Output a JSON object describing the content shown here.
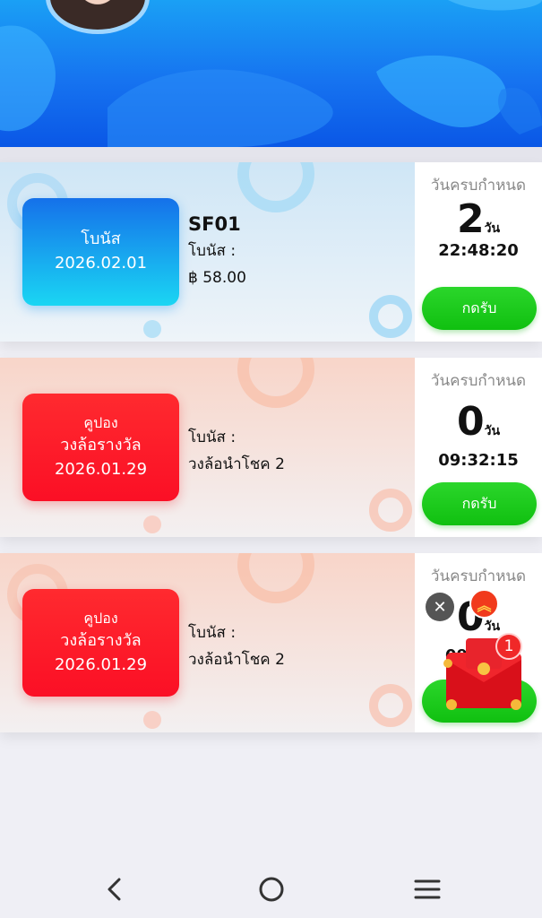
{
  "header": {
    "colors": {
      "top": "#1aa0f5",
      "bottom": "#0a57e6"
    }
  },
  "cards": [
    {
      "theme": "blue",
      "badge": {
        "line1": "โบนัส",
        "line2": "2026.02.01"
      },
      "code": "SF01",
      "label": "โบนัส :",
      "value": "฿ 58.00",
      "due_label": "วันครบกำหนด",
      "days": "2",
      "days_unit": "วัน",
      "time": "22:48:20",
      "claim": "กดรับ"
    },
    {
      "theme": "red",
      "badge": {
        "line0": "คูปอง",
        "line1": "วงล้อรางวัล",
        "line2": "2026.01.29"
      },
      "label": "โบนัส :",
      "value": "วงล้อนำโชค 2",
      "due_label": "วันครบกำหนด",
      "days": "0",
      "days_unit": "วัน",
      "time": "09:32:15",
      "claim": "กดรับ"
    },
    {
      "theme": "red",
      "badge": {
        "line0": "คูปอง",
        "line1": "วงล้อรางวัล",
        "line2": "2026.01.29"
      },
      "label": "โบนัส :",
      "value": "วงล้อนำโชค 2",
      "due_label": "วันครบกำหนด",
      "days": "0",
      "days_unit": "วัน",
      "time_partial": "09"
    }
  ],
  "floating": {
    "close_icon": "close-icon",
    "up_icon": "double-chevron-up-icon",
    "notification_count": "1"
  },
  "colors": {
    "claim_green": "#16c916",
    "badge_red": "#ff1e2d",
    "badge_blue": "#1a9cf0"
  }
}
